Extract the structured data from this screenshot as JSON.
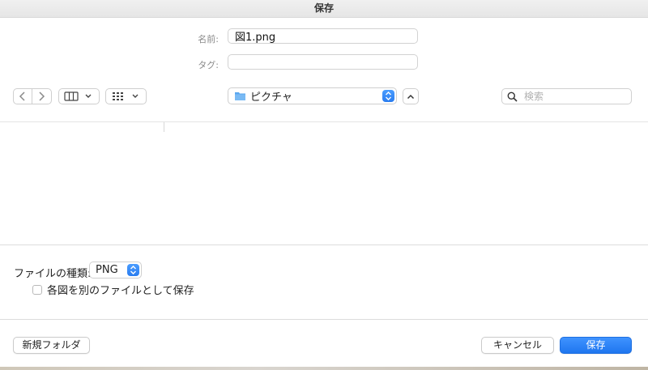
{
  "window": {
    "title": "保存"
  },
  "fields": {
    "name_label": "名前:",
    "name_value": "図1.png",
    "tags_label": "タグ:",
    "tags_value": ""
  },
  "toolbar": {
    "location_label": "ピクチャ",
    "search_placeholder": "検索"
  },
  "options": {
    "file_type_label": "ファイルの種類:",
    "file_type_value": "PNG",
    "checkbox_label": "各図を別のファイルとして保存"
  },
  "footer": {
    "new_folder": "新規フォルダ",
    "cancel": "キャンセル",
    "save": "保存"
  },
  "colors": {
    "primary": "#2a7df0",
    "folder": "#5aa7ef"
  },
  "icons": {
    "back": "chevron-left-icon",
    "forward": "chevron-right-icon",
    "columns": "columns-view-icon",
    "grid": "grid-view-icon",
    "folder": "folder-icon",
    "updown": "popup-arrows-icon",
    "expand": "chevron-up-icon",
    "search": "magnifier-icon"
  }
}
